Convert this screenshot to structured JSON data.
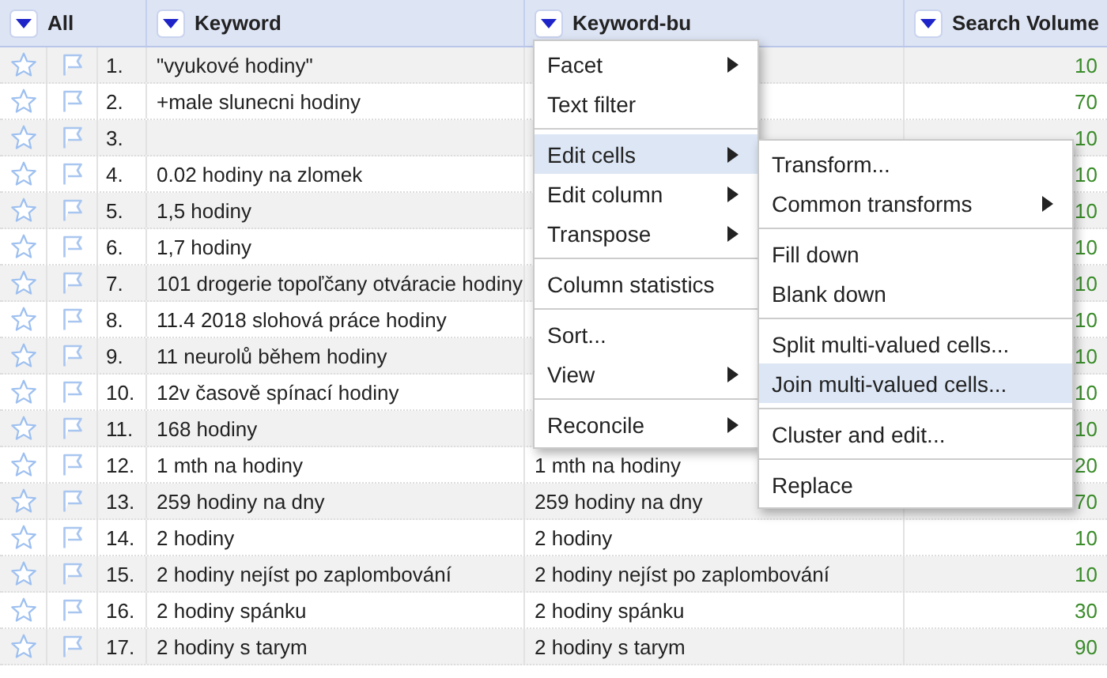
{
  "columns": [
    {
      "label": "All"
    },
    {
      "label": "Keyword"
    },
    {
      "label": "Keyword-bu"
    },
    {
      "label": "Search Volume"
    }
  ],
  "rows": [
    {
      "index": "1.",
      "keyword": "\"vyukové hodiny\"",
      "volume": "10"
    },
    {
      "index": "2.",
      "keyword": "+male slunecni hodiny",
      "volume": "70"
    },
    {
      "index": "3.",
      "volume": "10"
    },
    {
      "index": "4.",
      "keyword": "0.02 hodiny na zlomek",
      "volume": "10"
    },
    {
      "index": "5.",
      "keyword": "1,5 hodiny",
      "volume": "10"
    },
    {
      "index": "6.",
      "keyword": "1,7 hodiny",
      "volume": "10"
    },
    {
      "index": "7.",
      "keyword": "101 drogerie topoľčany otváracie hodiny",
      "volume": "10"
    },
    {
      "index": "8.",
      "keyword": "11.4 2018 slohová práce hodiny",
      "volume": "10"
    },
    {
      "index": "9.",
      "keyword": "11 neurolů během hodiny",
      "volume": "10"
    },
    {
      "index": "10.",
      "keyword": "12v časově spínací hodiny",
      "volume": "10"
    },
    {
      "index": "11.",
      "keyword": "168 hodiny",
      "volume": "10"
    },
    {
      "index": "12.",
      "keyword": "1 mth na hodiny",
      "keyword_bu": "1 mth na hodiny",
      "volume": "20"
    },
    {
      "index": "13.",
      "keyword": "259 hodiny na dny",
      "keyword_bu": "259 hodiny na dny",
      "volume": "70"
    },
    {
      "index": "14.",
      "keyword": "2 hodiny",
      "keyword_bu": "2 hodiny",
      "volume": "10"
    },
    {
      "index": "15.",
      "keyword": "2 hodiny nejíst po zaplombování",
      "keyword_bu": "2 hodiny nejíst po zaplombování",
      "volume": "10"
    },
    {
      "index": "16.",
      "keyword": "2 hodiny spánku",
      "keyword_bu": "2 hodiny spánku",
      "volume": "30"
    },
    {
      "index": "17.",
      "keyword": "2 hodiny s tarym",
      "keyword_bu": "2 hodiny s tarym",
      "volume": "90"
    }
  ],
  "column_menu": [
    {
      "kind": "item",
      "label": "Facet",
      "submenu": true,
      "selected": false
    },
    {
      "kind": "item",
      "label": "Text filter",
      "submenu": false,
      "selected": false
    },
    {
      "kind": "separator"
    },
    {
      "kind": "item",
      "label": "Edit cells",
      "submenu": true,
      "selected": true
    },
    {
      "kind": "item",
      "label": "Edit column",
      "submenu": true,
      "selected": false
    },
    {
      "kind": "item",
      "label": "Transpose",
      "submenu": true,
      "selected": false
    },
    {
      "kind": "separator"
    },
    {
      "kind": "item",
      "label": "Column statistics",
      "submenu": false,
      "selected": false
    },
    {
      "kind": "separator"
    },
    {
      "kind": "item",
      "label": "Sort...",
      "submenu": false,
      "selected": false
    },
    {
      "kind": "item",
      "label": "View",
      "submenu": true,
      "selected": false
    },
    {
      "kind": "separator"
    },
    {
      "kind": "item",
      "label": "Reconcile",
      "submenu": true,
      "selected": false
    }
  ],
  "edit_cells_submenu": [
    {
      "kind": "item",
      "label": "Transform...",
      "submenu": false,
      "selected": false
    },
    {
      "kind": "item",
      "label": "Common transforms",
      "submenu": true,
      "selected": false
    },
    {
      "kind": "separator"
    },
    {
      "kind": "item",
      "label": "Fill down",
      "submenu": false,
      "selected": false
    },
    {
      "kind": "item",
      "label": "Blank down",
      "submenu": false,
      "selected": false
    },
    {
      "kind": "separator"
    },
    {
      "kind": "item",
      "label": "Split multi-valued cells...",
      "submenu": false,
      "selected": false
    },
    {
      "kind": "item",
      "label": "Join multi-valued cells...",
      "submenu": false,
      "selected": true
    },
    {
      "kind": "separator"
    },
    {
      "kind": "item",
      "label": "Cluster and edit...",
      "submenu": false,
      "selected": false
    },
    {
      "kind": "separator"
    },
    {
      "kind": "item",
      "label": "Replace",
      "submenu": false,
      "selected": false
    }
  ]
}
